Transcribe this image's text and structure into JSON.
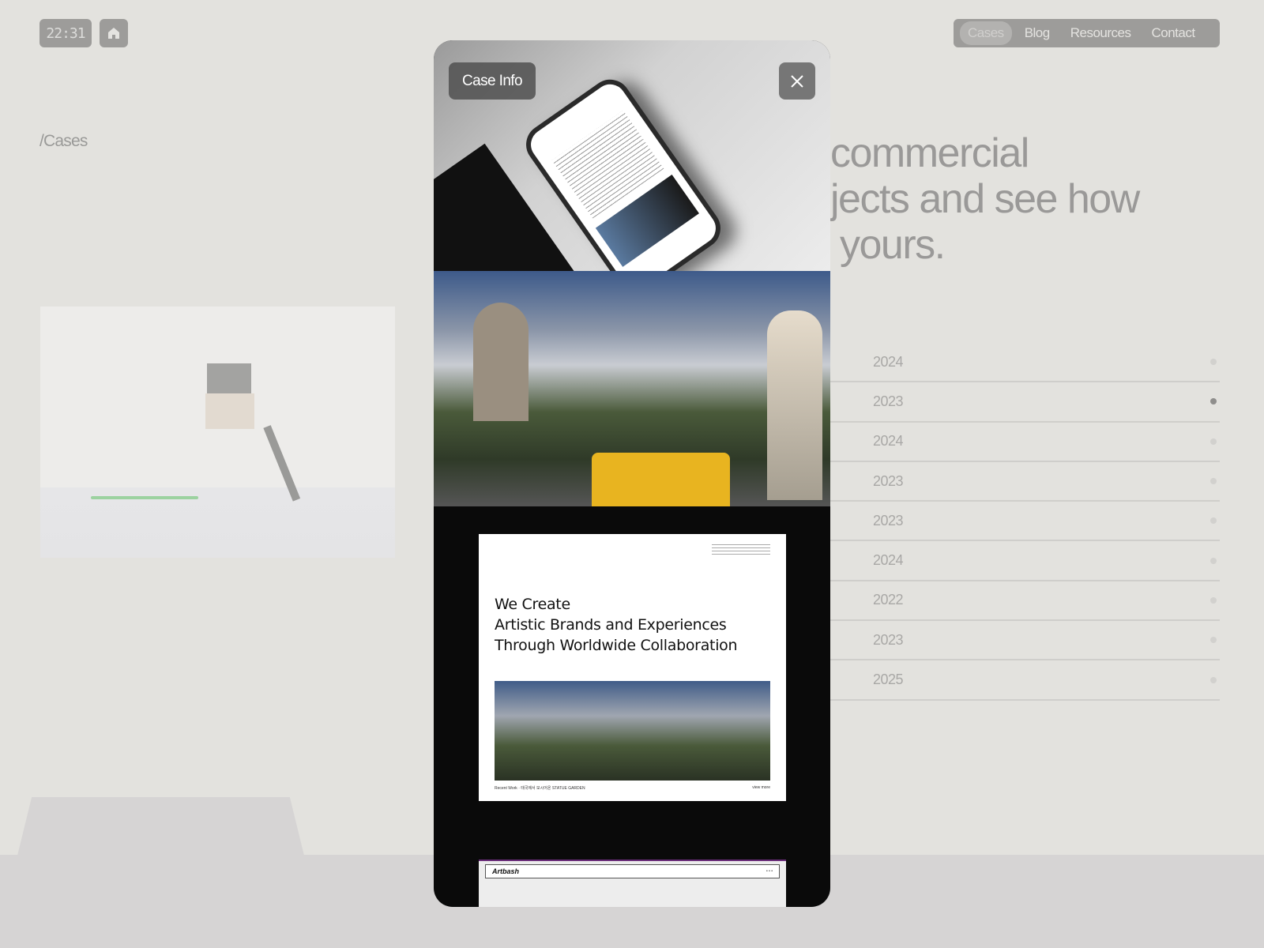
{
  "header": {
    "clock": "22:31",
    "home_icon": "home-icon",
    "nav": [
      {
        "label": "Cases",
        "active": true
      },
      {
        "label": "Blog"
      },
      {
        "label": "Resources"
      },
      {
        "label": "Contact"
      }
    ]
  },
  "breadcrumb": "/Cases",
  "heading_fragments": [
    "commercial",
    "jects and see how",
    "yours."
  ],
  "list": {
    "years": [
      "2024",
      "2023",
      "2024",
      "2023",
      "2023",
      "2024",
      "2022",
      "2023",
      "2025"
    ],
    "active_index": 1
  },
  "modal": {
    "case_info_label": "Case Info",
    "close_icon": "close-icon",
    "card": {
      "title_lines": [
        "We Create",
        "Artistic Brands and Experiences",
        "Through Worldwide Collaboration"
      ],
      "caption": "Recent Work · 태국에서 모시어온 STATUE GARDEN",
      "caption_link": "view more"
    },
    "card2": {
      "logo": "Artbash"
    }
  },
  "colors": {
    "background": "#e3e2de",
    "nav_bg": "#9d9c9a",
    "modal_bg": "#0a0a0a"
  }
}
